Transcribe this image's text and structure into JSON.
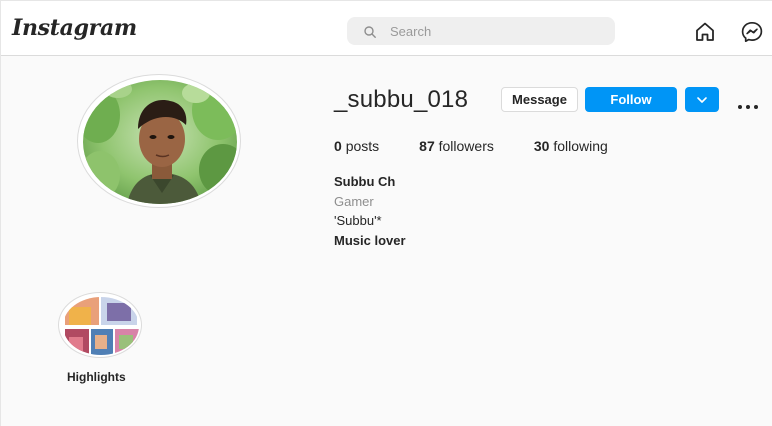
{
  "header": {
    "logo": "Instagram",
    "search_placeholder": "Search",
    "icons": [
      "home-icon",
      "messenger-icon",
      "search-icon"
    ]
  },
  "profile": {
    "username": "_subbu_018",
    "message_label": "Message",
    "follow_label": "Follow",
    "stats": {
      "posts_count": "0",
      "posts_label": "posts",
      "followers_count": "87",
      "followers_label": "followers",
      "following_count": "30",
      "following_label": "following"
    },
    "bio": {
      "name": "Subbu Ch",
      "category": "Gamer",
      "line1": "'Subbu'*",
      "line2": "Music lover"
    }
  },
  "highlights": {
    "label": "Highlights"
  },
  "colors": {
    "accent": "#0095f6",
    "text": "#262626",
    "muted": "#8e8e8e",
    "border": "#dbdbdb",
    "background": "#fafafa"
  }
}
